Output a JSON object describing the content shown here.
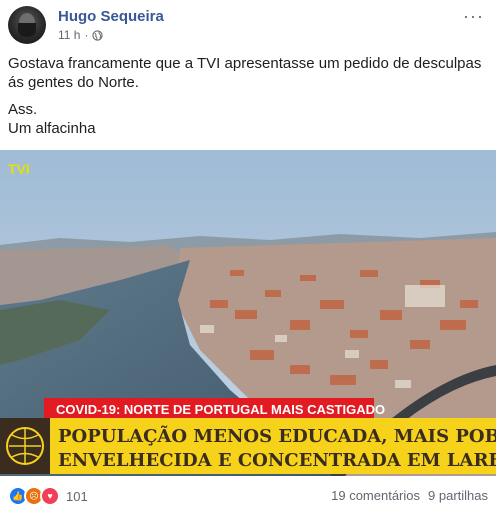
{
  "post": {
    "author": "Hugo Sequeira",
    "time": "11 h",
    "text_line1": "Gostava francamente que a TVI apresentasse um pedido de desculpas ás gentes do Norte.",
    "text_line2": "Ass.",
    "text_line3": "Um alfacinha",
    "audience_icon": "globe-icon",
    "menu_icon": "more-options-icon"
  },
  "tv_image": {
    "banner_top": "COVID-19: NORTE DE PORTUGAL MAIS CASTIGADO",
    "banner_line1": "POPULAÇÃO MENOS EDUCADA, MAIS POBRE,",
    "banner_line2": "ENVELHECIDA E CONCENTRADA EM LARES",
    "channel_logo": "TVI"
  },
  "footer": {
    "reaction_count": "101",
    "comments": "19 comentários",
    "shares": "9 partilhas",
    "reaction_icons": [
      "like-icon",
      "angry-icon",
      "love-icon"
    ]
  },
  "colors": {
    "author": "#385898",
    "banner_red": "#e21b23",
    "banner_yellow": "#f7d21a",
    "like": "#1877f2",
    "angry": "#e9710f",
    "love": "#f33e58"
  }
}
